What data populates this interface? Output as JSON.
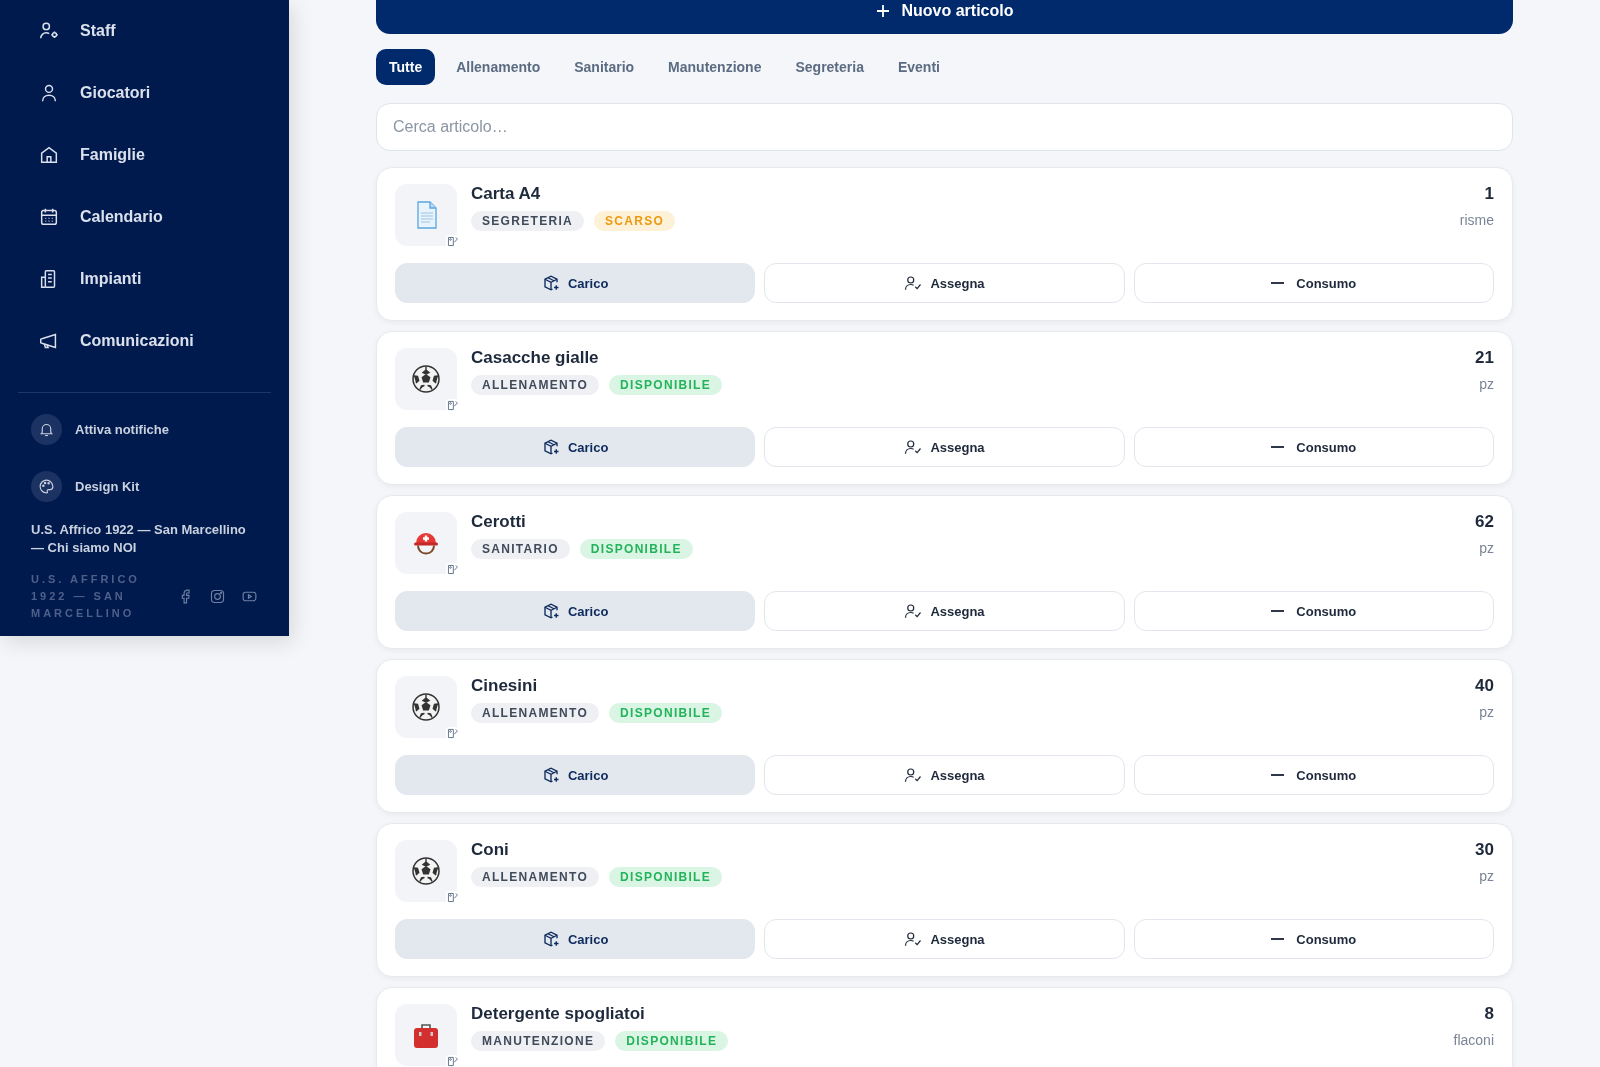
{
  "sidebar": {
    "nav_items": [
      {
        "label": "Staff"
      },
      {
        "label": "Giocatori"
      },
      {
        "label": "Famiglie"
      },
      {
        "label": "Calendario"
      },
      {
        "label": "Impianti"
      },
      {
        "label": "Comunicazioni"
      }
    ],
    "actions": [
      {
        "label": "Attiva notifiche"
      },
      {
        "label": "Design Kit"
      }
    ],
    "footer_link": "U.S. Affrico 1922 — San Marcellino — Chi siamo NOI",
    "footer_brand": "U.S. AFFRICO 1922 — SAN MARCELLINO"
  },
  "new_button": {
    "label": "Nuovo articolo"
  },
  "tabs": [
    {
      "label": "Tutte",
      "selected": true
    },
    {
      "label": "Allenamento",
      "selected": false
    },
    {
      "label": "Sanitario",
      "selected": false
    },
    {
      "label": "Manutenzione",
      "selected": false
    },
    {
      "label": "Segreteria",
      "selected": false
    },
    {
      "label": "Eventi",
      "selected": false
    }
  ],
  "search": {
    "placeholder": "Cerca articolo…"
  },
  "items": [
    {
      "name": "Carta A4",
      "kind": "document",
      "category": "SEGRETERIA",
      "status": {
        "label": "SCARSO",
        "kind": "low"
      },
      "quantity": "1",
      "unit": "risme",
      "actions": [
        "Carico",
        "Assegna",
        "Consumo"
      ]
    },
    {
      "name": "Casacche gialle",
      "kind": "ball",
      "category": "ALLENAMENTO",
      "status": {
        "label": "DISPONIBILE",
        "kind": "available"
      },
      "quantity": "21",
      "unit": "pz",
      "actions": [
        "Carico",
        "Assegna",
        "Consumo"
      ]
    },
    {
      "name": "Cerotti",
      "kind": "helmet",
      "category": "SANITARIO",
      "status": {
        "label": "DISPONIBILE",
        "kind": "available"
      },
      "quantity": "62",
      "unit": "pz",
      "actions": [
        "Carico",
        "Assegna",
        "Consumo"
      ]
    },
    {
      "name": "Cinesini",
      "kind": "ball",
      "category": "ALLENAMENTO",
      "status": {
        "label": "DISPONIBILE",
        "kind": "available"
      },
      "quantity": "40",
      "unit": "pz",
      "actions": [
        "Carico",
        "Assegna",
        "Consumo"
      ]
    },
    {
      "name": "Coni",
      "kind": "ball",
      "category": "ALLENAMENTO",
      "status": {
        "label": "DISPONIBILE",
        "kind": "available"
      },
      "quantity": "30",
      "unit": "pz",
      "actions": [
        "Carico",
        "Assegna",
        "Consumo"
      ]
    },
    {
      "name": "Detergente spogliatoi",
      "kind": "toolbox",
      "category": "MANUTENZIONE",
      "status": {
        "label": "DISPONIBILE",
        "kind": "available"
      },
      "quantity": "8",
      "unit": "flaconi"
    }
  ]
}
